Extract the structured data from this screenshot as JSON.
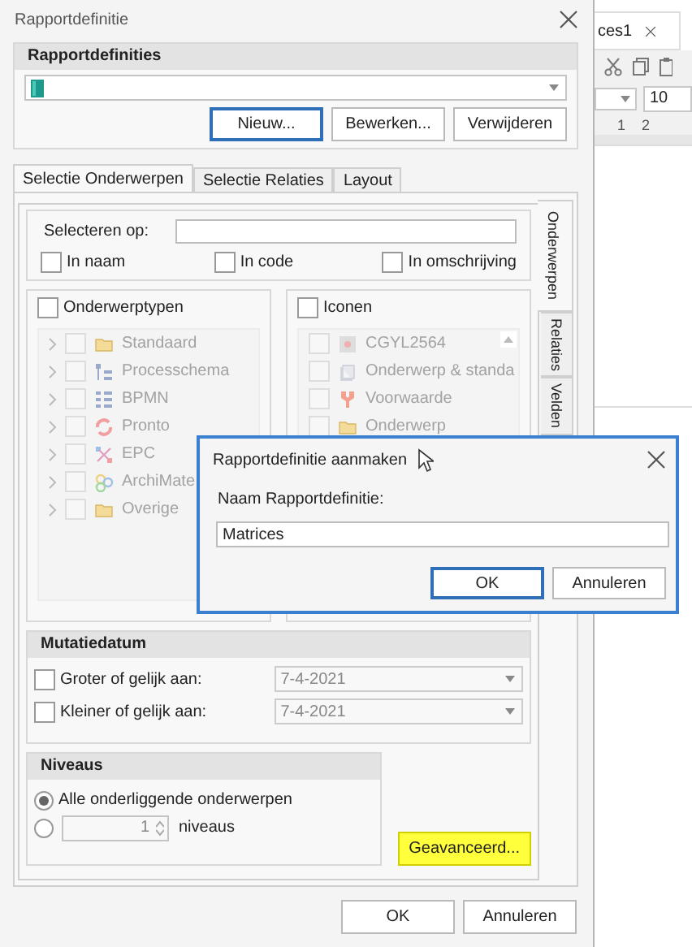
{
  "window": {
    "title": "Rapportdefinitie"
  },
  "definitions": {
    "heading": "Rapportdefinities",
    "buttons": [
      {
        "label": "Nieuw...",
        "focused": true
      },
      {
        "label": "Bewerken...",
        "focused": false
      },
      {
        "label": "Verwijderen",
        "focused": false
      }
    ]
  },
  "tabs": [
    {
      "label": "Selectie Onderwerpen",
      "selected": true
    },
    {
      "label": "Selectie Relaties",
      "selected": false
    },
    {
      "label": "Layout",
      "selected": false
    }
  ],
  "side_tabs": [
    {
      "label": "Onderwerpen",
      "selected": true
    },
    {
      "label": "Relaties",
      "selected": false
    },
    {
      "label": "Velden",
      "selected": false
    }
  ],
  "search": {
    "label": "Selecteren op:",
    "options": [
      {
        "label": "In naam",
        "checked": false
      },
      {
        "label": "In code",
        "checked": false
      },
      {
        "label": "In omschrijving",
        "checked": false
      }
    ]
  },
  "type_list": {
    "label": "Onderwerptypen",
    "checked": false,
    "disabled": true,
    "items": [
      {
        "label": "Standaard",
        "kind": "folder"
      },
      {
        "label": "Processchema",
        "kind": "tree"
      },
      {
        "label": "BPMN",
        "kind": "list"
      },
      {
        "label": "Pronto",
        "kind": "cycle"
      },
      {
        "label": "EPC",
        "kind": "network"
      },
      {
        "label": "ArchiMate",
        "kind": "circles"
      },
      {
        "label": "Overige",
        "kind": "folder"
      }
    ]
  },
  "icon_list": {
    "label": "Iconen",
    "checked": false,
    "disabled": true,
    "items": [
      {
        "label": "CGYL2564",
        "kind": "image"
      },
      {
        "label": "Onderwerp & standa",
        "kind": "pages"
      },
      {
        "label": "Voorwaarde",
        "kind": "fork"
      },
      {
        "label": "Onderwerp",
        "kind": "folder"
      }
    ]
  },
  "mutation_date": {
    "heading": "Mutatiedatum",
    "rows": [
      {
        "label": "Groter of gelijk aan:",
        "checked": false,
        "value": "7-4-2021"
      },
      {
        "label": "Kleiner of gelijk aan:",
        "checked": false,
        "value": "7-4-2021"
      }
    ]
  },
  "levels": {
    "heading": "Niveaus",
    "options": [
      {
        "kind": "all",
        "label": "Alle onderliggende onderwerpen",
        "selected": true
      },
      {
        "kind": "count",
        "value": "1",
        "unit": "niveaus",
        "selected": false
      }
    ]
  },
  "advanced_button": {
    "label": "Geavanceerd...",
    "highlighted": true
  },
  "footer_buttons": [
    "OK",
    "Annuleren"
  ],
  "modal": {
    "title": "Rapportdefinitie aanmaken",
    "field_label": "Naam Rapportdefinitie:",
    "value": "Matrices",
    "buttons": [
      {
        "label": "OK",
        "focused": true
      },
      {
        "label": "Annuleren",
        "focused": false
      }
    ]
  },
  "background_app": {
    "tab": "ces1",
    "font_size": "10",
    "ruler": [
      "1",
      "2"
    ]
  }
}
